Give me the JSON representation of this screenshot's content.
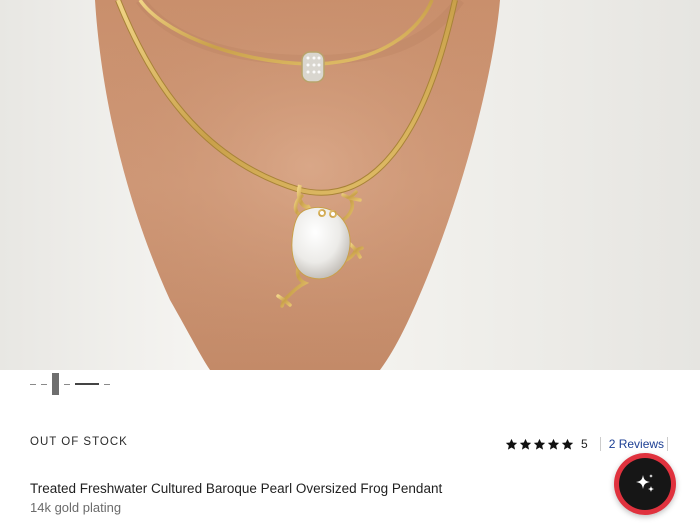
{
  "product": {
    "stock_status": "OUT OF STOCK",
    "title": "Treated Freshwater Cultured Baroque Pearl Oversized Frog Pendant",
    "subtitle": "14k gold plating",
    "image_alt": "product-photo-frog-pendant-necklace"
  },
  "rating": {
    "stars": 5,
    "star_color": "#111111",
    "count": "5",
    "reviews_label": "2 Reviews"
  },
  "carousel": {
    "total_indicators": 5,
    "active_index": 2
  },
  "assistant": {
    "icon": "sparkle-icon",
    "ring_color": "#e0323e"
  }
}
